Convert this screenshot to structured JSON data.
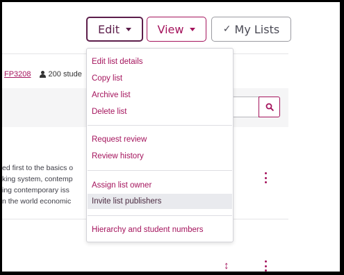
{
  "toolbar": {
    "edit_label": "Edit",
    "view_label": "View",
    "mylists_label": "My Lists"
  },
  "meta": {
    "course_code": "FP3208",
    "student_count": "200 stude"
  },
  "description": {
    "lines": [
      "ed first to the basics o",
      "king system, contemp",
      "ing contemporary iss",
      "n the world economic"
    ]
  },
  "edit_menu": {
    "group1": [
      "Edit list details",
      "Copy list",
      "Archive list",
      "Delete list"
    ],
    "group2": [
      "Request review",
      "Review history"
    ],
    "group3": [
      "Assign list owner",
      "Invite list publishers"
    ],
    "group4": [
      "Hierarchy and student numbers"
    ],
    "highlighted_item": "Invite list publishers"
  },
  "colors": {
    "accent": "#a4135c",
    "edit_border": "#5c1d4a",
    "highlight_bg": "#e9eaee"
  },
  "icons": [
    "caret-down-icon",
    "checkmark-icon",
    "person-icon",
    "search-icon",
    "kebab-menu-icon",
    "sort-arrows-icon"
  ]
}
